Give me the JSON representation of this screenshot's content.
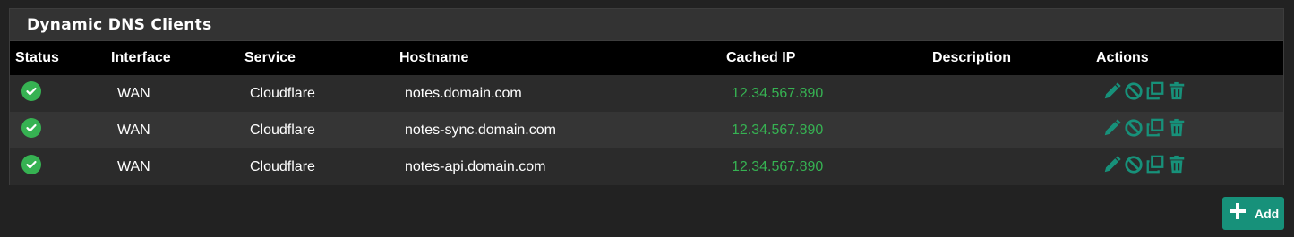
{
  "panel": {
    "title": "Dynamic DNS Clients"
  },
  "table": {
    "headers": [
      "Status",
      "Interface",
      "Service",
      "Hostname",
      "Cached IP",
      "Description",
      "Actions"
    ],
    "rows": [
      {
        "status": "ok",
        "interface": "WAN",
        "service": "Cloudflare",
        "hostname": "notes.domain.com",
        "cached_ip": "12.34.567.890",
        "description": ""
      },
      {
        "status": "ok",
        "interface": "WAN",
        "service": "Cloudflare",
        "hostname": "notes-sync.domain.com",
        "cached_ip": "12.34.567.890",
        "description": ""
      },
      {
        "status": "ok",
        "interface": "WAN",
        "service": "Cloudflare",
        "hostname": "notes-api.domain.com",
        "cached_ip": "12.34.567.890",
        "description": ""
      }
    ],
    "action_icons": [
      "pencil-icon",
      "ban-icon",
      "clone-icon",
      "trash-icon"
    ]
  },
  "add_button": {
    "label": "Add",
    "icon": "plus-icon"
  },
  "colors": {
    "accent": "#17917a",
    "status_ok": "#36b252",
    "ip_text": "#36b252",
    "header_bg": "#000000"
  }
}
